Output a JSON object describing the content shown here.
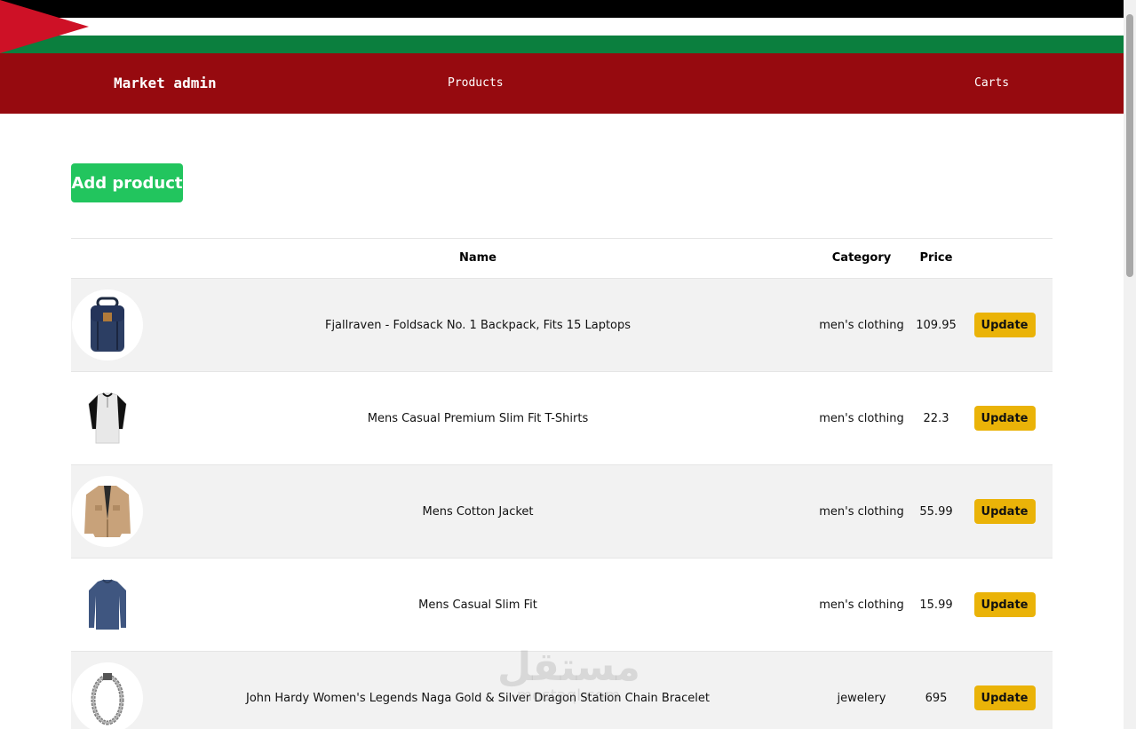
{
  "header": {
    "brand": "Market admin",
    "nav": [
      {
        "label": "Products"
      },
      {
        "label": "Carts"
      }
    ]
  },
  "colors": {
    "flag_black": "#000000",
    "flag_white": "#ffffff",
    "flag_green": "#0b7f3e",
    "flag_red": "#ce1126",
    "navbar": "#960a0f",
    "add_button": "#22c55e",
    "update_button": "#eab308",
    "alt_row": "#f2f2f2"
  },
  "toolbar": {
    "add_label": "Add product"
  },
  "table": {
    "columns": [
      "",
      "Name",
      "Category",
      "Price",
      ""
    ],
    "rows": [
      {
        "icon": "backpack-image",
        "name": "Fjallraven - Foldsack No. 1 Backpack, Fits 15 Laptops",
        "category": "men's clothing",
        "price": "109.95",
        "action": "Update"
      },
      {
        "icon": "tshirt-image",
        "name": "Mens Casual Premium Slim Fit T-Shirts",
        "category": "men's clothing",
        "price": "22.3",
        "action": "Update"
      },
      {
        "icon": "jacket-image",
        "name": "Mens Cotton Jacket",
        "category": "men's clothing",
        "price": "55.99",
        "action": "Update"
      },
      {
        "icon": "longsleeve-image",
        "name": "Mens Casual Slim Fit",
        "category": "men's clothing",
        "price": "15.99",
        "action": "Update"
      },
      {
        "icon": "bracelet-image",
        "name": "John Hardy Women's Legends Naga Gold & Silver Dragon Station Chain Bracelet",
        "category": "jewelery",
        "price": "695",
        "action": "Update"
      }
    ]
  },
  "watermark": {
    "arabic": "مستقل",
    "latin": "mostaql.com"
  }
}
